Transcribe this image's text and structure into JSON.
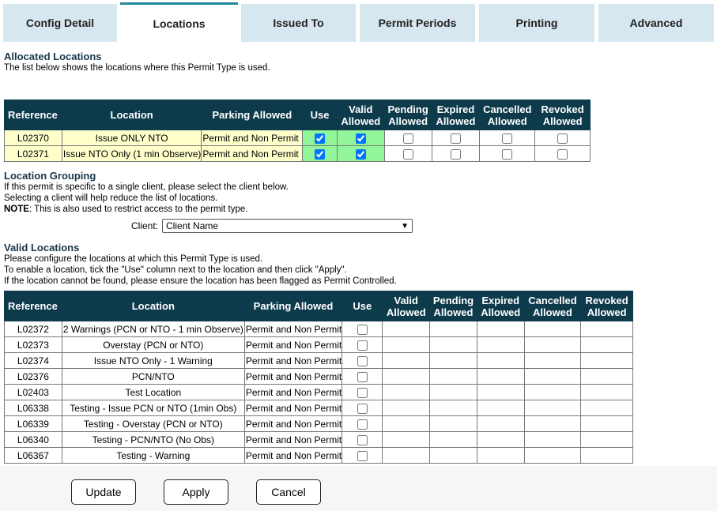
{
  "tabs": [
    {
      "label": "Config Detail",
      "active": false
    },
    {
      "label": "Locations",
      "active": true
    },
    {
      "label": "Issued To",
      "active": false
    },
    {
      "label": "Permit Periods",
      "active": false
    },
    {
      "label": "Printing",
      "active": false
    },
    {
      "label": "Advanced",
      "active": false
    }
  ],
  "allocated": {
    "title": "Allocated Locations",
    "description": "The list below shows the locations where this Permit Type is used.",
    "headers": [
      "Reference",
      "Location",
      "Parking Allowed",
      "Use",
      "Valid Allowed",
      "Pending Allowed",
      "Expired Allowed",
      "Cancelled Allowed",
      "Revoked Allowed"
    ],
    "rows": [
      {
        "reference": "L02370",
        "location": "Issue ONLY NTO",
        "parking": "Permit and Non Permit",
        "use": true,
        "valid": true,
        "pending": false,
        "expired": false,
        "cancelled": false,
        "revoked": false
      },
      {
        "reference": "L02371",
        "location": "Issue NTO Only (1 min Observe)",
        "parking": "Permit and Non Permit",
        "use": true,
        "valid": true,
        "pending": false,
        "expired": false,
        "cancelled": false,
        "revoked": false
      }
    ]
  },
  "grouping": {
    "title": "Location Grouping",
    "line1": "If this permit is specific to a single client, please select the client below.",
    "line2": "Selecting a client will help reduce the list of locations.",
    "note_label": "NOTE",
    "note_text": ": This is also used to restrict access to the permit type.",
    "client_label": "Client:",
    "client_value": "Client Name"
  },
  "valid": {
    "title": "Valid Locations",
    "line1": "Please configure the locations at which this Permit Type is used.",
    "line2": "To enable a location, tick the \"Use\" column next to the location and then click \"Apply\".",
    "line3": "If the location cannot be found, please ensure the location has been flagged as Permit Controlled.",
    "headers": [
      "Reference",
      "Location",
      "Parking Allowed",
      "Use",
      "Valid Allowed",
      "Pending Allowed",
      "Expired Allowed",
      "Cancelled Allowed",
      "Revoked Allowed"
    ],
    "rows": [
      {
        "reference": "L02372",
        "location": "2 Warnings (PCN or NTO - 1 min Observe)",
        "parking": "Permit and Non Permit"
      },
      {
        "reference": "L02373",
        "location": "Overstay (PCN or NTO)",
        "parking": "Permit and Non Permit"
      },
      {
        "reference": "L02374",
        "location": "Issue NTO Only - 1 Warning",
        "parking": "Permit and Non Permit"
      },
      {
        "reference": "L02376",
        "location": "PCN/NTO",
        "parking": "Permit and Non Permit"
      },
      {
        "reference": "L02403",
        "location": "Test Location",
        "parking": "Permit and Non Permit"
      },
      {
        "reference": "L06338",
        "location": "Testing - Issue PCN or NTO (1min Obs)",
        "parking": "Permit and Non Permit"
      },
      {
        "reference": "L06339",
        "location": "Testing - Overstay (PCN or NTO)",
        "parking": "Permit and Non Permit"
      },
      {
        "reference": "L06340",
        "location": "Testing - PCN/NTO (No Obs)",
        "parking": "Permit and Non Permit"
      },
      {
        "reference": "L06367",
        "location": "Testing - Warning",
        "parking": "Permit and Non Permit"
      }
    ]
  },
  "buttons": {
    "update": "Update",
    "apply": "Apply",
    "cancel": "Cancel"
  }
}
